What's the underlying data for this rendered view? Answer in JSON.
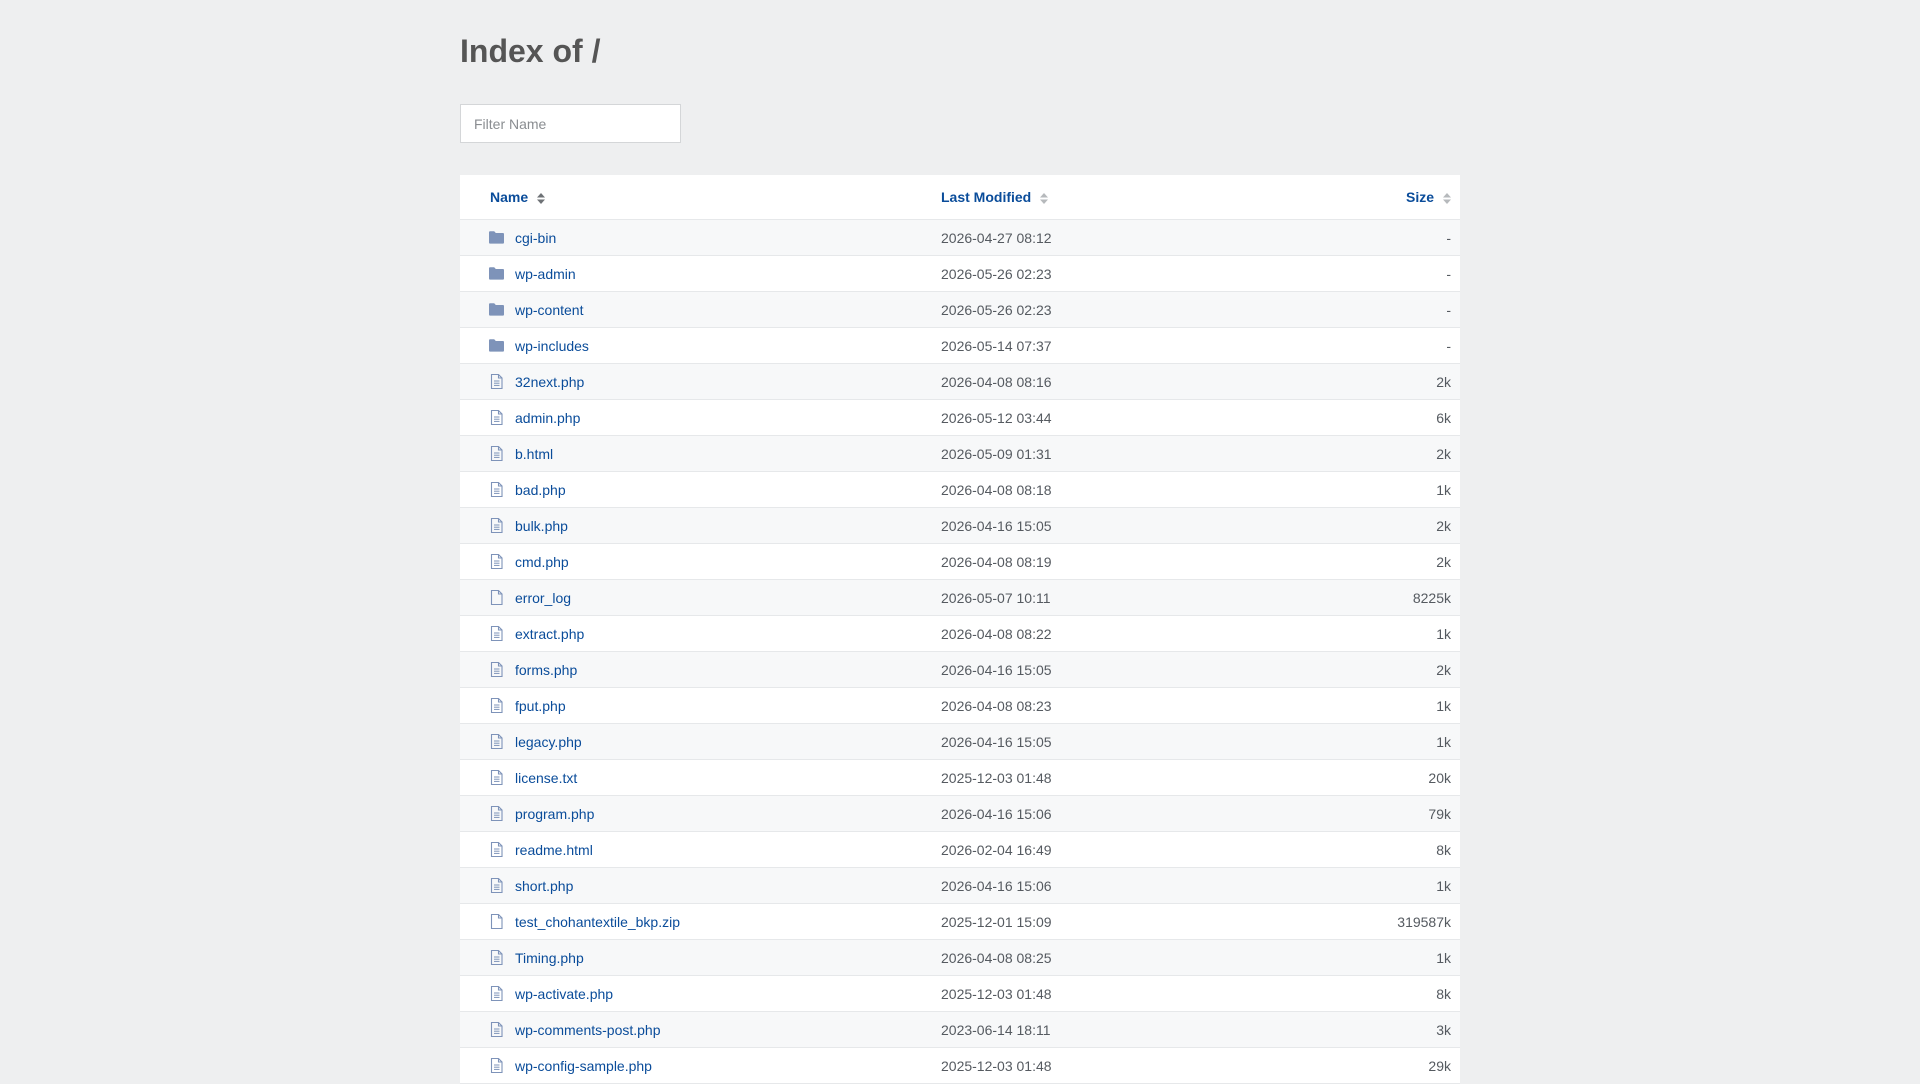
{
  "page": {
    "title": "Index of /",
    "filter_placeholder": "Filter Name"
  },
  "columns": {
    "name": "Name",
    "modified": "Last Modified",
    "size": "Size"
  },
  "colors": {
    "link": "#0a4c9a",
    "icon": "#7e93b9",
    "background": "#eeeff0"
  },
  "entries": [
    {
      "name": "cgi-bin",
      "modified": "2026-04-27 08:12",
      "size": "-",
      "type": "folder"
    },
    {
      "name": "wp-admin",
      "modified": "2026-05-26 02:23",
      "size": "-",
      "type": "folder"
    },
    {
      "name": "wp-content",
      "modified": "2026-05-26 02:23",
      "size": "-",
      "type": "folder"
    },
    {
      "name": "wp-includes",
      "modified": "2026-05-14 07:37",
      "size": "-",
      "type": "folder"
    },
    {
      "name": "32next.php",
      "modified": "2026-04-08 08:16",
      "size": "2k",
      "type": "file-text"
    },
    {
      "name": "admin.php",
      "modified": "2026-05-12 03:44",
      "size": "6k",
      "type": "file-text"
    },
    {
      "name": "b.html",
      "modified": "2026-05-09 01:31",
      "size": "2k",
      "type": "file-text"
    },
    {
      "name": "bad.php",
      "modified": "2026-04-08 08:18",
      "size": "1k",
      "type": "file-text"
    },
    {
      "name": "bulk.php",
      "modified": "2026-04-16 15:05",
      "size": "2k",
      "type": "file-text"
    },
    {
      "name": "cmd.php",
      "modified": "2026-04-08 08:19",
      "size": "2k",
      "type": "file-text"
    },
    {
      "name": "error_log",
      "modified": "2026-05-07 10:11",
      "size": "8225k",
      "type": "file"
    },
    {
      "name": "extract.php",
      "modified": "2026-04-08 08:22",
      "size": "1k",
      "type": "file-text"
    },
    {
      "name": "forms.php",
      "modified": "2026-04-16 15:05",
      "size": "2k",
      "type": "file-text"
    },
    {
      "name": "fput.php",
      "modified": "2026-04-08 08:23",
      "size": "1k",
      "type": "file-text"
    },
    {
      "name": "legacy.php",
      "modified": "2026-04-16 15:05",
      "size": "1k",
      "type": "file-text"
    },
    {
      "name": "license.txt",
      "modified": "2025-12-03 01:48",
      "size": "20k",
      "type": "file-text"
    },
    {
      "name": "program.php",
      "modified": "2026-04-16 15:06",
      "size": "79k",
      "type": "file-text"
    },
    {
      "name": "readme.html",
      "modified": "2026-02-04 16:49",
      "size": "8k",
      "type": "file-text"
    },
    {
      "name": "short.php",
      "modified": "2026-04-16 15:06",
      "size": "1k",
      "type": "file-text"
    },
    {
      "name": "test_chohantextile_bkp.zip",
      "modified": "2025-12-01 15:09",
      "size": "319587k",
      "type": "file"
    },
    {
      "name": "Timing.php",
      "modified": "2026-04-08 08:25",
      "size": "1k",
      "type": "file-text"
    },
    {
      "name": "wp-activate.php",
      "modified": "2025-12-03 01:48",
      "size": "8k",
      "type": "file-text"
    },
    {
      "name": "wp-comments-post.php",
      "modified": "2023-06-14 18:11",
      "size": "3k",
      "type": "file-text"
    },
    {
      "name": "wp-config-sample.php",
      "modified": "2025-12-03 01:48",
      "size": "29k",
      "type": "file-text"
    }
  ]
}
